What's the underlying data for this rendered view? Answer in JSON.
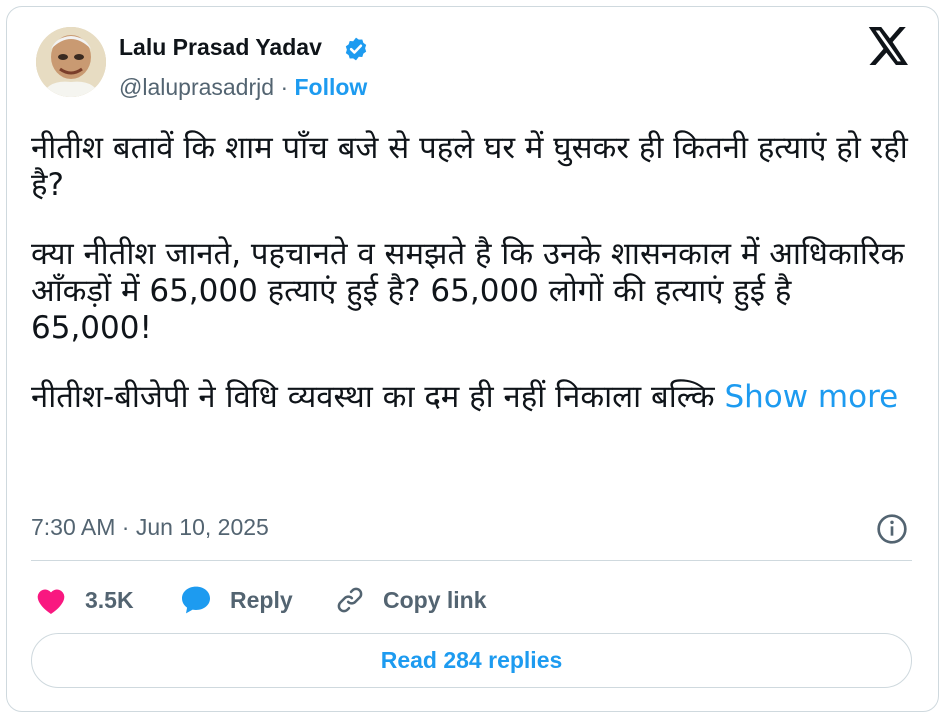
{
  "tweet": {
    "author": {
      "name": "Lalu Prasad Yadav",
      "handle": "@laluprasadrjd",
      "separator": "·",
      "follow_label": "Follow",
      "verified": true
    },
    "paragraphs": [
      "नीतीश बतावें कि शाम पाँच बजे से पहले घर में घुसकर ही कितनी हत्याएं हो रही है?",
      "क्या नीतीश जानते, पहचानते व समझते है कि उनके शासनकाल में आधिकारिक आँकड़ों में 65,000 हत्याएं हुई है? 65,000 लोगों की हत्याएं हुई है 65,000!",
      "नीतीश-बीजेपी ने विधि व्यवस्था का दम ही नहीं निकाला बल्कि"
    ],
    "show_more_label": "Show more",
    "timestamp": "7:30 AM · Jun 10, 2025",
    "actions": {
      "like_count": "3.5K",
      "reply_label": "Reply",
      "copy_link_label": "Copy link"
    },
    "read_replies_label": "Read 284 replies"
  },
  "icons": {
    "verified": "verified-badge-icon",
    "logo": "x-logo-icon",
    "info": "info-icon",
    "like": "heart-icon",
    "reply": "speech-bubble-icon",
    "copy": "link-icon"
  },
  "colors": {
    "accent": "#1d9bf0",
    "like": "#f91880",
    "text": "#0f1419",
    "muted": "#536471",
    "border": "#cfd9de"
  }
}
